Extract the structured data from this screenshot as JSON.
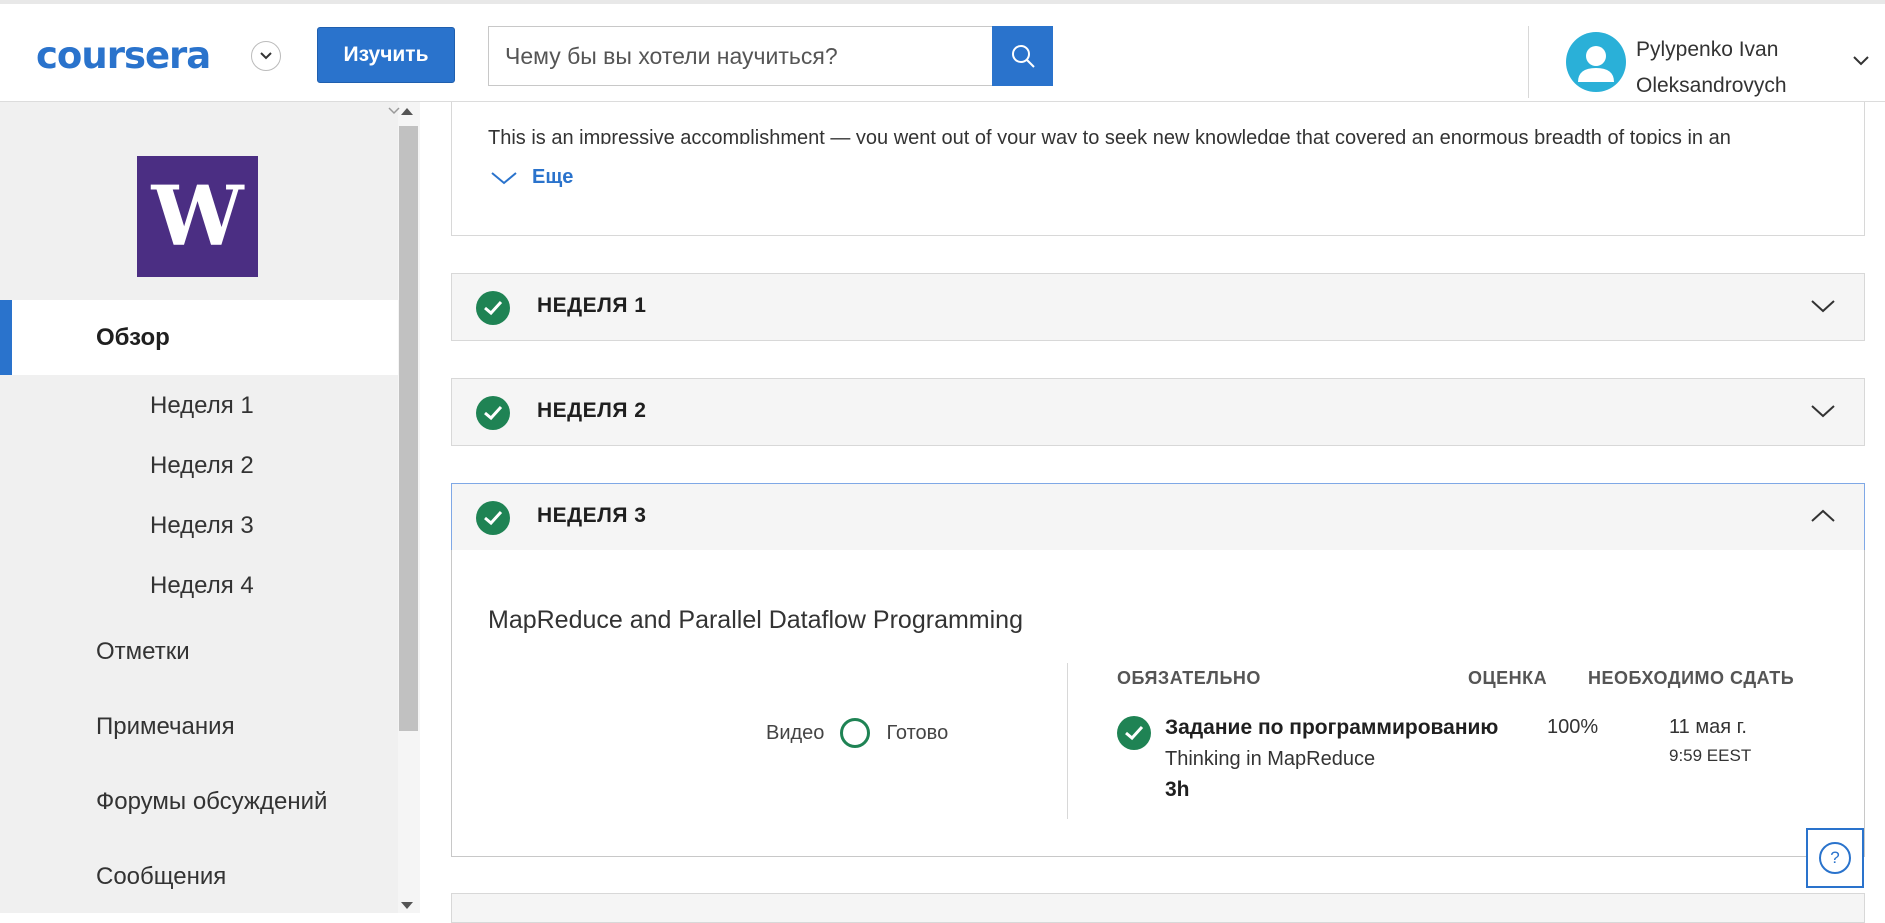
{
  "header": {
    "logo_text": "coursera",
    "explore_label": "Изучить",
    "search_placeholder": "Чему бы вы хотели научиться?",
    "user_name": "Pylypenko Ivan Oleksandrovych"
  },
  "sidebar": {
    "institution_logo": "W",
    "items": [
      {
        "label": "Обзор"
      },
      {
        "label": "Неделя 1"
      },
      {
        "label": "Неделя 2"
      },
      {
        "label": "Неделя 3"
      },
      {
        "label": "Неделя 4"
      },
      {
        "label": "Отметки"
      },
      {
        "label": "Примечания"
      },
      {
        "label": "Форумы обсуждений"
      },
      {
        "label": "Сообщения"
      }
    ]
  },
  "main": {
    "about_text": "This is an impressive accomplishment — you went out of your way to seek new knowledge that covered an enormous breadth of topics in an",
    "more_label": "Еще",
    "weeks": [
      {
        "title": "НЕДЕЛЯ 1"
      },
      {
        "title": "НЕДЕЛЯ 2"
      },
      {
        "title": "НЕДЕЛЯ 3"
      }
    ],
    "week3": {
      "description": "MapReduce and Parallel Dataflow Programming",
      "video_label": "Видео",
      "video_status": "Готово",
      "col_required": "ОБЯЗАТЕЛЬНО",
      "col_grade": "ОЦЕНКА",
      "col_due": "НЕОБХОДИМО СДАТЬ",
      "task": {
        "title": "Задание по программированию",
        "subtitle": "Thinking in MapReduce",
        "duration": "3h",
        "grade": "100%",
        "due_date": "11 мая г.",
        "due_time": "9:59 EEST"
      }
    }
  },
  "colors": {
    "accent": "#2a73cc",
    "success": "#1f8354",
    "institution": "#4b2e83"
  }
}
